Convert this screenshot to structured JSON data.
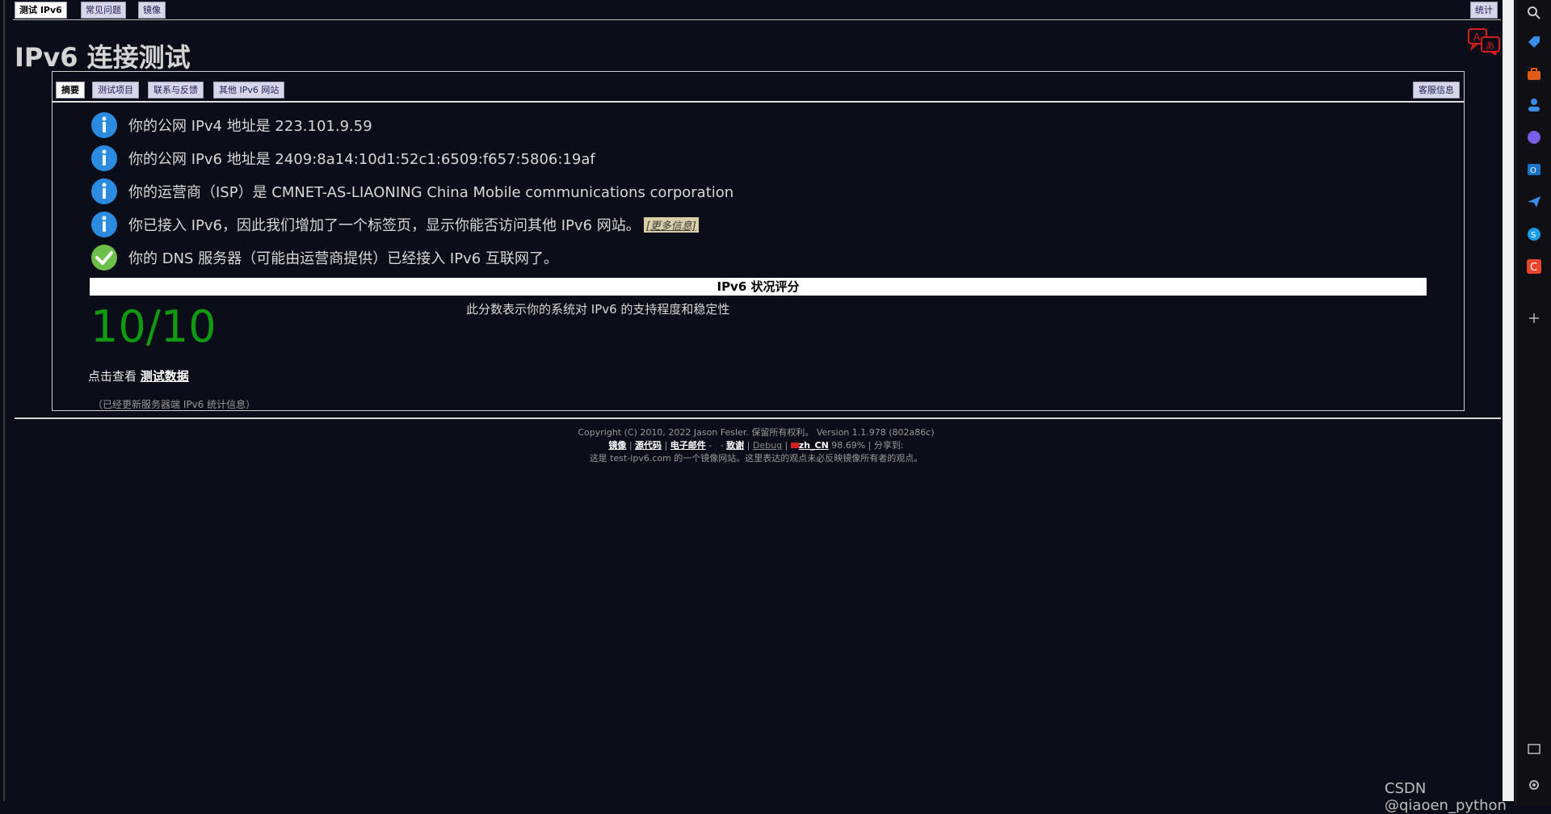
{
  "top_tabs": [
    "测试 IPv6",
    "常见问题",
    "镜像"
  ],
  "top_right_tab": "统计",
  "page_title": "IPv6 连接测试",
  "box_tabs": [
    "摘要",
    "测试项目",
    "联系与反馈",
    "其他 IPv6 网站"
  ],
  "box_right_tab": "客服信息",
  "results": [
    {
      "icon": "info-icon",
      "text": "你的公网 IPv4 地址是 223.101.9.59"
    },
    {
      "icon": "info-icon",
      "text": "你的公网 IPv6 地址是 2409:8a14:10d1:52c1:6509:f657:5806:19af"
    },
    {
      "icon": "info-icon",
      "text": "你的运营商（ISP）是 CMNET-AS-LIAONING China Mobile communications corporation"
    },
    {
      "icon": "info-icon",
      "text": "你已接入 IPv6，因此我们增加了一个标签页，显示你能否访问其他 IPv6 网站。",
      "link": "[更多信息]"
    },
    {
      "icon": "check-icon",
      "text": "你的 DNS 服务器（可能由运营商提供）已经接入 IPv6 互联网了。"
    }
  ],
  "score": {
    "header": "IPv6 状况评分",
    "value": "10/10",
    "note": "此分数表示你的系统对 IPv6 的支持程度和稳定性"
  },
  "view_data": {
    "prefix": "点击查看 ",
    "link": "测试数据"
  },
  "stats_note": "（已经更新服务器端 IPv6 统计信息）",
  "footer": {
    "line1": "Copyright (C) 2010, 2022 Jason Fesler. 保留所有权利。 Version 1.1.978 (802a86c)",
    "links": [
      "镜像",
      "源代码",
      "电子邮件",
      "致谢",
      "Debug",
      "zh_CN"
    ],
    "percent": "98.69% | 分享到:",
    "line3": "这是 test-ipv6.com 的一个镜像网站。这里表达的观点未必反映镜像所有者的观点。"
  },
  "watermark": "CSDN @qiaoen_python",
  "colors": {
    "score_green": "#119911",
    "info_blue": "#2b8be0",
    "check_green": "#6cc04a"
  }
}
